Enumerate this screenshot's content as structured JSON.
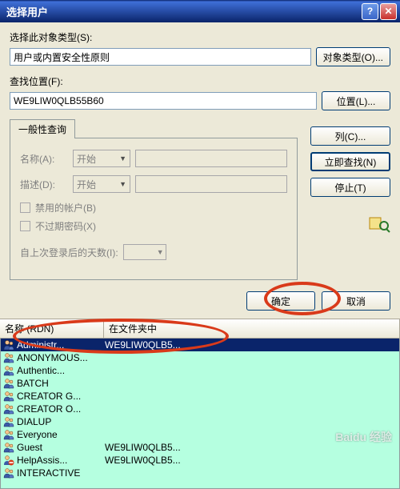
{
  "title": "选择用户",
  "section1": {
    "label": "选择此对象类型(S):",
    "value": "用户或内置安全性原则",
    "button": "对象类型(O)..."
  },
  "section2": {
    "label": "查找位置(F):",
    "value": "WE9LIW0QLB55B60",
    "button": "位置(L)..."
  },
  "tab": {
    "label": "一般性查询"
  },
  "query": {
    "name_label": "名称(A):",
    "name_combo": "开始",
    "desc_label": "描述(D):",
    "desc_combo": "开始",
    "chk1": "禁用的帐户(B)",
    "chk2": "不过期密码(X)",
    "days_label": "自上次登录后的天数(I):"
  },
  "sidebar": {
    "columns": "列(C)...",
    "findnow": "立即查找(N)",
    "stop": "停止(T)"
  },
  "okrow": {
    "ok": "确定",
    "cancel": "取消"
  },
  "listheader": {
    "col1": "名称 (RDN)",
    "col2": "在文件夹中"
  },
  "rows": [
    {
      "name": "Administr...",
      "folder": "WE9LIW0QLB5...",
      "selected": true,
      "icon": "user"
    },
    {
      "name": "ANONYMOUS...",
      "folder": "",
      "icon": "user"
    },
    {
      "name": "Authentic...",
      "folder": "",
      "icon": "user"
    },
    {
      "name": "BATCH",
      "folder": "",
      "icon": "user"
    },
    {
      "name": "CREATOR G...",
      "folder": "",
      "icon": "user"
    },
    {
      "name": "CREATOR O...",
      "folder": "",
      "icon": "user"
    },
    {
      "name": "DIALUP",
      "folder": "",
      "icon": "user"
    },
    {
      "name": "Everyone",
      "folder": "",
      "icon": "user"
    },
    {
      "name": "Guest",
      "folder": "WE9LIW0QLB5...",
      "icon": "user"
    },
    {
      "name": "HelpAssis...",
      "folder": "WE9LIW0QLB5...",
      "icon": "deny"
    },
    {
      "name": "INTERACTIVE",
      "folder": "",
      "icon": "user"
    }
  ],
  "watermark": "Baidu 经验"
}
